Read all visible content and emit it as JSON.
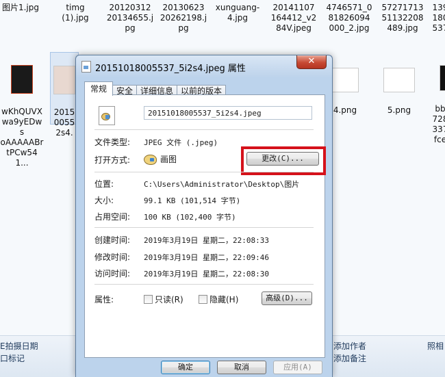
{
  "background": {
    "files": [
      {
        "name": "图片1.jpg"
      },
      {
        "name": "timg\n(1).jpg"
      },
      {
        "name": "20120312\n20134655.j\npg"
      },
      {
        "name": "20130623\n20262198.j\npg"
      },
      {
        "name": "xunguang-\n4.jpg"
      },
      {
        "name": "20141107\n164412_v2\n84V.jpeg"
      },
      {
        "name": "4746571_0\n81826094\n000_2.jpg"
      },
      {
        "name": "57271713\n51132208\n489.jpg"
      },
      {
        "name": "139\n180\n537"
      },
      {
        "name": "wKhQUVX\nwa9yEDws\noAAAAABr\ntPCw541..."
      },
      {
        "name": "2015\n0055\n2s4."
      },
      {
        "name": "4.png"
      },
      {
        "name": "5.png"
      },
      {
        "name": "bb\n728\n337\nfce"
      }
    ],
    "bottom": {
      "col1_line1": "E拍摄日期",
      "col1_line2": "口标记",
      "col2_line1": "添加作者",
      "col2_line2": "添加备注",
      "col3_line1": "照相"
    }
  },
  "dialog": {
    "title": "20151018005537_5i2s4.jpeg 属性",
    "close_glyph": "✕",
    "tabs": [
      "常规",
      "安全",
      "详细信息",
      "以前的版本"
    ],
    "filename": "20151018005537_5i2s4.jpeg",
    "type_label": "文件类型:",
    "type_value": "JPEG 文件 (.jpeg)",
    "open_label": "打开方式:",
    "open_value": "画图",
    "change_button": "更改(C)...",
    "location_label": "位置:",
    "location_value": "C:\\Users\\Administrator\\Desktop\\图片",
    "size_label": "大小:",
    "size_value": "99.1 KB (101,514 字节)",
    "disk_label": "占用空间:",
    "disk_value": "100 KB (102,400 字节)",
    "created_label": "创建时间:",
    "created_value": "2019年3月19日 星期二，22:08:33",
    "modified_label": "修改时间:",
    "modified_value": "2019年3月19日 星期二，22:09:46",
    "accessed_label": "访问时间:",
    "accessed_value": "2019年3月19日 星期二，22:08:30",
    "attr_label": "属性:",
    "readonly_label": "只读(R)",
    "hidden_label": "隐藏(H)",
    "advanced_button": "高级(D)...",
    "ok_button": "确定",
    "cancel_button": "取消",
    "apply_button": "应用(A)"
  },
  "colors": {
    "highlight": "#d5121b",
    "close_button": "#c74a34"
  }
}
